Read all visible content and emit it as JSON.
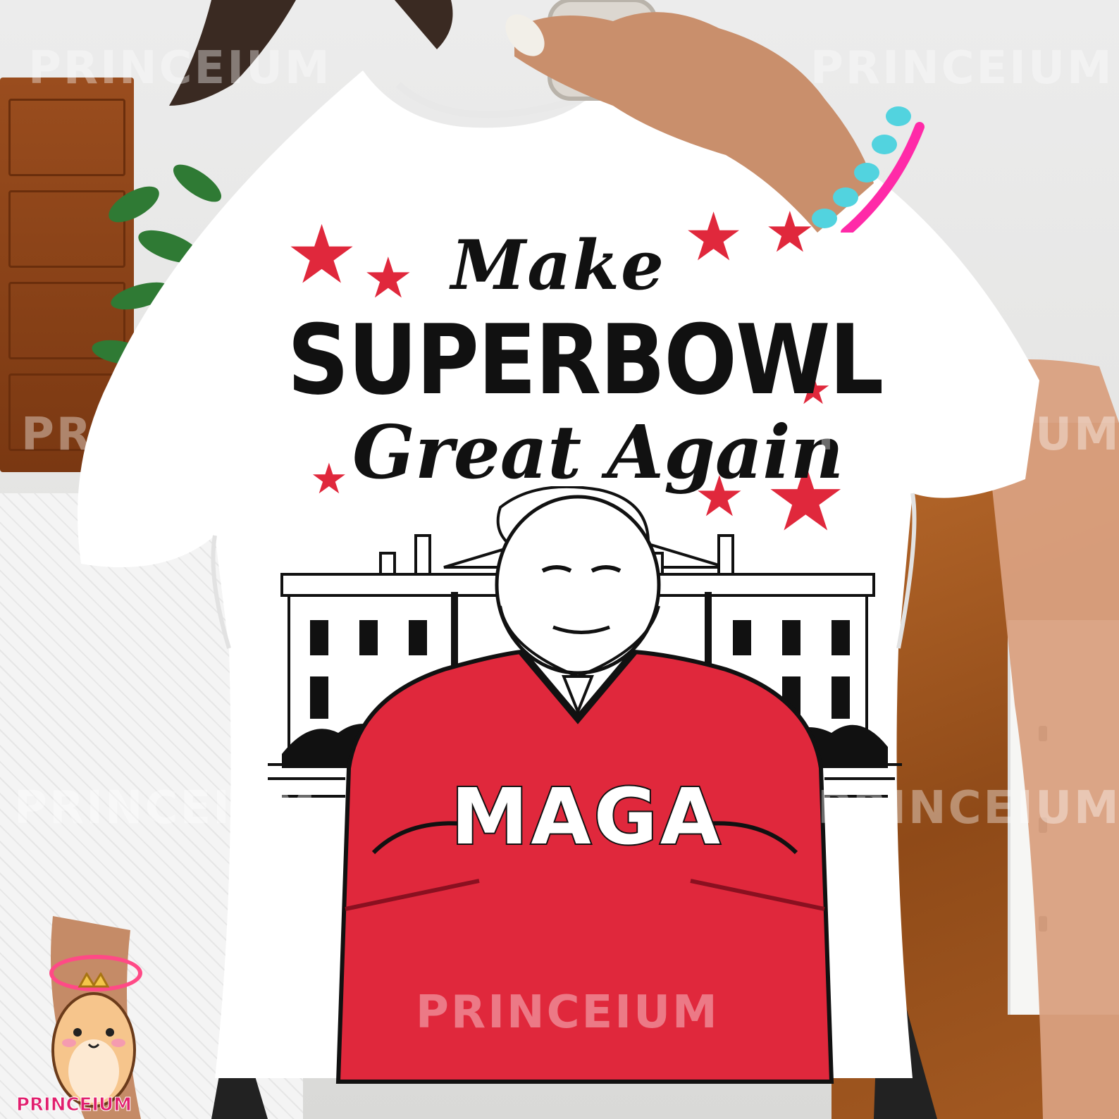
{
  "shirt": {
    "line1": "Make",
    "line2": "SUPERBOWL",
    "line3": "Great Again",
    "jersey_text": "MAGA"
  },
  "watermark": {
    "text": "PRINCEIUM"
  },
  "logo": {
    "text": "PRINCEIUM"
  },
  "colors": {
    "accent_red": "#e0283c",
    "ink": "#111111",
    "shirt": "#ffffff",
    "logo_pink": "#e11f6e"
  },
  "icons": [
    "star-icon",
    "hamster-mascot-icon"
  ]
}
